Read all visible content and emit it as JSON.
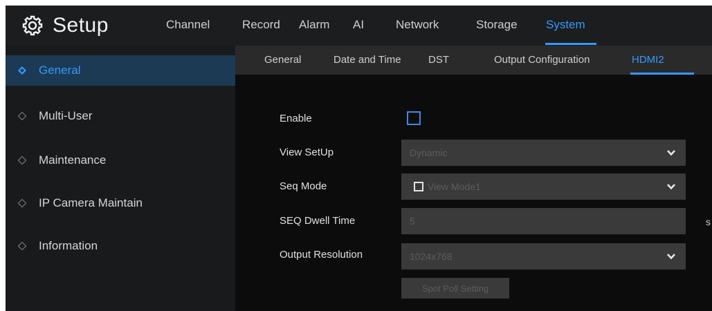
{
  "header": {
    "title": "Setup",
    "menu": [
      "Channel",
      "Record",
      "Alarm",
      "AI",
      "Network",
      "Storage",
      "System"
    ],
    "active_menu": "System"
  },
  "sidebar": {
    "items": [
      {
        "label": "General",
        "active": true
      },
      {
        "label": "Multi-User",
        "active": false
      },
      {
        "label": "Maintenance",
        "active": false
      },
      {
        "label": "IP Camera Maintain",
        "active": false
      },
      {
        "label": "Information",
        "active": false
      }
    ]
  },
  "subtabs": {
    "items": [
      "General",
      "Date and Time",
      "DST",
      "Output Configuration",
      "HDMI2"
    ],
    "active": "HDMI2"
  },
  "form": {
    "enable_label": "Enable",
    "enable_checked": false,
    "view_setup_label": "View SetUp",
    "view_setup_value": "Dynamic",
    "seq_mode_label": "Seq Mode",
    "seq_mode_value": "View Mode1",
    "seq_dwell_label": "SEQ Dwell Time",
    "seq_dwell_value": "5",
    "seq_dwell_unit": "s",
    "output_res_label": "Output Resolution",
    "output_res_value": "1024x768",
    "spot_poll_label": "Spot Poll Setting"
  },
  "colors": {
    "accent": "#2f9bff",
    "topbar_bg": "#1c1d1f",
    "sidebar_bg": "#181a1c",
    "active_item_bg": "#1d3a55",
    "content_bg": "#0c0c0d",
    "field_bg": "#3a3a3b"
  },
  "icons": {
    "brand": "gear-icon",
    "sidebar_item": "diamond-icon",
    "dropdown": "chevron-down-icon"
  }
}
